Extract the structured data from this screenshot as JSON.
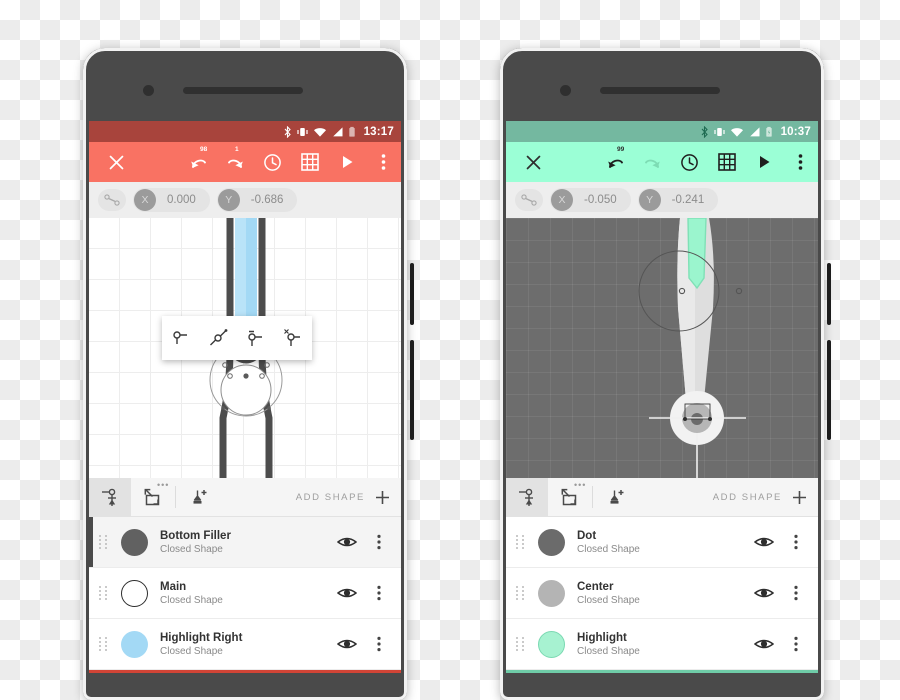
{
  "phones": [
    {
      "id": "left-phone",
      "theme": {
        "status_bar": "#A8443C",
        "toolbar": "#F97263",
        "nav_bar": "#D24436",
        "on_toolbar": "#FFFFFF",
        "canvas_bg": "#FFFFFF"
      },
      "status_bar": {
        "time": "13:17"
      },
      "toolbar": {
        "close_label": "close",
        "undo_badge": "98",
        "redo_badge": "1",
        "redo_enabled": true,
        "buttons": [
          "undo",
          "redo",
          "history",
          "grid",
          "play",
          "overflow"
        ]
      },
      "coord_bar": {
        "x_label": "X",
        "x_value": "0.000",
        "y_label": "Y",
        "y_value": "-0.686"
      },
      "canvas": {
        "grid": "light",
        "shape_fill": "#9BD4F2",
        "shape_stroke": "#4D4D4D",
        "node_popup_tools": [
          "node-corner",
          "node-smooth",
          "node-symmetric",
          "node-delete"
        ]
      },
      "tabs": {
        "items": [
          "path-edit-tool",
          "transform-tool",
          "pen-tool"
        ],
        "active_index": 0,
        "overflow_badge": "•••",
        "add_shape_label": "ADD SHAPE"
      },
      "layers": [
        {
          "name": "Bottom Filler",
          "type": "Closed Shape",
          "color": "#616161",
          "outlined": false,
          "selected": true
        },
        {
          "name": "Main",
          "type": "Closed Shape",
          "color": "#FFFFFF",
          "outlined": true,
          "selected": false
        },
        {
          "name": "Highlight Right",
          "type": "Closed Shape",
          "color": "#A3D9F5",
          "outlined": false,
          "selected": false
        }
      ],
      "nav_bar": {
        "buttons": [
          "back",
          "home",
          "recents"
        ]
      }
    },
    {
      "id": "right-phone",
      "theme": {
        "status_bar": "#74B8A0",
        "toolbar": "#9BFFD6",
        "nav_bar": "#6FCCA8",
        "on_toolbar": "#333333",
        "canvas_bg": "#6D6D6D"
      },
      "status_bar": {
        "time": "10:37"
      },
      "toolbar": {
        "close_label": "close",
        "undo_badge": "99",
        "redo_badge": "",
        "redo_enabled": false,
        "buttons": [
          "undo",
          "redo",
          "history",
          "grid",
          "play",
          "overflow"
        ]
      },
      "coord_bar": {
        "x_label": "X",
        "x_value": "-0.050",
        "y_label": "Y",
        "y_value": "-0.241"
      },
      "canvas": {
        "grid": "dark",
        "shape_fill": "#9BF5CE",
        "shape_stroke": "#E0E0E0",
        "node_popup_tools": []
      },
      "tabs": {
        "items": [
          "path-edit-tool",
          "transform-tool",
          "pen-tool"
        ],
        "active_index": 0,
        "overflow_badge": "•••",
        "add_shape_label": "ADD SHAPE"
      },
      "layers": [
        {
          "name": "Dot",
          "type": "Closed Shape",
          "color": "#6B6B6B",
          "outlined": false,
          "selected": false
        },
        {
          "name": "Center",
          "type": "Closed Shape",
          "color": "#B4B4B4",
          "outlined": false,
          "selected": false
        },
        {
          "name": "Highlight",
          "type": "Closed Shape",
          "color": "#A7F2D1",
          "outlined": true,
          "selected": false
        }
      ],
      "nav_bar": {
        "buttons": [
          "back",
          "home",
          "recents"
        ]
      }
    }
  ]
}
